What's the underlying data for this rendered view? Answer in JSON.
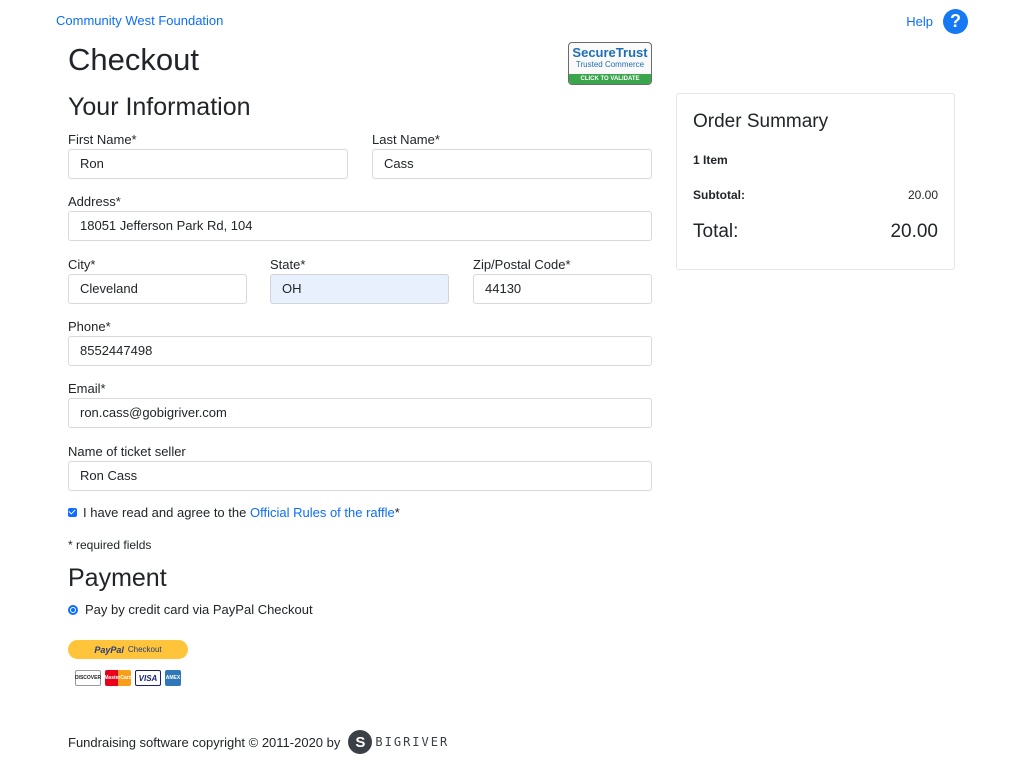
{
  "header": {
    "org_name": "Community West Foundation",
    "help_label": "Help",
    "help_icon": "question-circle-icon"
  },
  "page_title": "Checkout",
  "trust_badge": {
    "line1": "SecureTrust",
    "line2": "Trusted Commerce",
    "line3": "CLICK TO VALIDATE"
  },
  "info": {
    "title": "Your Information",
    "first_name": {
      "label": "First Name*",
      "value": "Ron"
    },
    "last_name": {
      "label": "Last Name*",
      "value": "Cass"
    },
    "address": {
      "label": "Address*",
      "value": "18051 Jefferson Park Rd, 104"
    },
    "city": {
      "label": "City*",
      "value": "Cleveland"
    },
    "state": {
      "label": "State*",
      "value": "OH"
    },
    "zip": {
      "label": "Zip/Postal Code*",
      "value": "44130"
    },
    "phone": {
      "label": "Phone*",
      "value": "8552447498"
    },
    "email": {
      "label": "Email*",
      "value": "ron.cass@gobigriver.com"
    },
    "seller": {
      "label": "Name of ticket seller",
      "value": "Ron Cass"
    },
    "agree_prefix": "I have read and agree to the",
    "agree_link": "Official Rules of the raffle",
    "agree_suffix": "*",
    "agree_checked": true,
    "required_note": "* required fields"
  },
  "payment": {
    "title": "Payment",
    "option_label": "Pay by credit card via PayPal Checkout",
    "paypal_brand": "PayPal",
    "paypal_label": "Checkout",
    "cards": [
      "DISCOVER",
      "MasterCard",
      "VISA",
      "AMEX"
    ]
  },
  "summary": {
    "title": "Order Summary",
    "item_count": "1 Item",
    "subtotal_label": "Subtotal:",
    "subtotal_value": "20.00",
    "total_label": "Total:",
    "total_value": "20.00"
  },
  "footer": {
    "copyright": "Fundraising software copyright © 2011-2020 by",
    "brand": "BIGRIVER"
  },
  "colors": {
    "link": "#0d6efd",
    "help_icon": "#1479f3",
    "paypal": "#ffc439",
    "state_bg": "#e8f0fe"
  }
}
